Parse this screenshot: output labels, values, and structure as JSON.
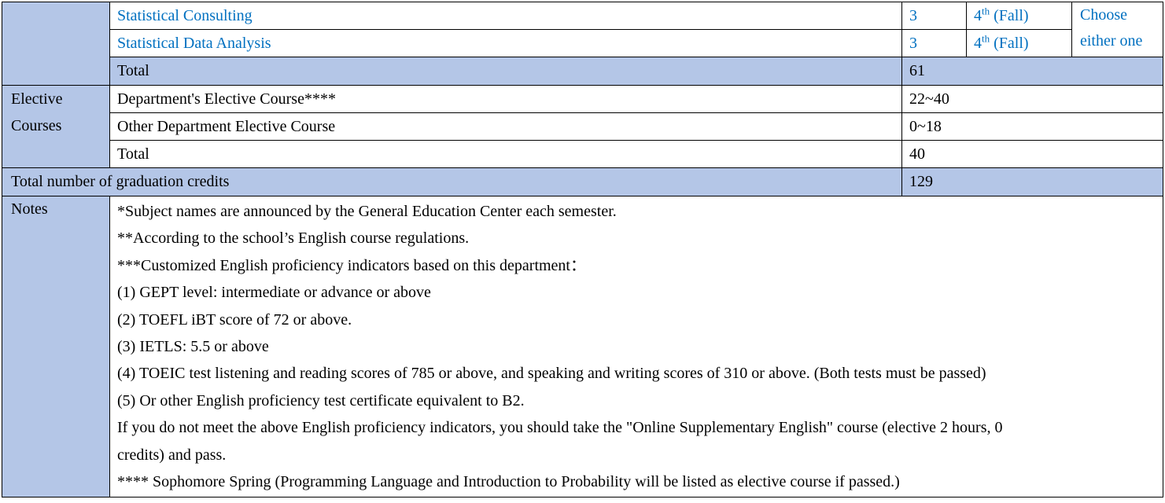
{
  "required_rows": [
    {
      "course": "Statistical Consulting",
      "credits": "3",
      "year": "4",
      "year_sup": "th",
      "semester": " (Fall)"
    },
    {
      "course": "Statistical Data Analysis",
      "credits": "3",
      "year": "4",
      "year_sup": "th",
      "semester": " (Fall)"
    }
  ],
  "choose_note": [
    "Choose",
    "either one"
  ],
  "required_total": {
    "label": "Total",
    "credits": "61"
  },
  "elective": {
    "label_lines": [
      "Elective",
      "Courses"
    ],
    "rows": [
      {
        "course": "Department's Elective Course****",
        "credits": "22~40"
      },
      {
        "course": "Other Department Elective Course",
        "credits": "0~18"
      }
    ],
    "total": {
      "label": "Total",
      "credits": "40"
    }
  },
  "graduation": {
    "label": "Total number of graduation credits",
    "credits": "129"
  },
  "notes": {
    "label": "Notes",
    "lines": [
      "*Subject names are announced by the General Education Center each semester.",
      "**According to the school’s English course regulations.",
      "***Customized English proficiency indicators based on this department：",
      "(1) GEPT level: intermediate or advance or above",
      "(2) TOEFL iBT score of 72 or above.",
      "(3) IETLS: 5.5 or above",
      "(4) TOEIC test listening and reading scores of 785 or above, and speaking and writing scores of 310 or above. (Both tests must be passed)",
      "(5) Or other English proficiency test certificate equivalent to B2.",
      "If you do not meet the above English proficiency indicators, you should take the \"Online Supplementary English\" course (elective 2 hours, 0",
      "credits) and pass.",
      "**** Sophomore Spring (Programming Language and Introduction to Probability will be listed as elective course if passed.)"
    ]
  },
  "colors": {
    "header_fill": "#b4c6e7",
    "course_link": "#0070c0",
    "border": "#000000"
  }
}
